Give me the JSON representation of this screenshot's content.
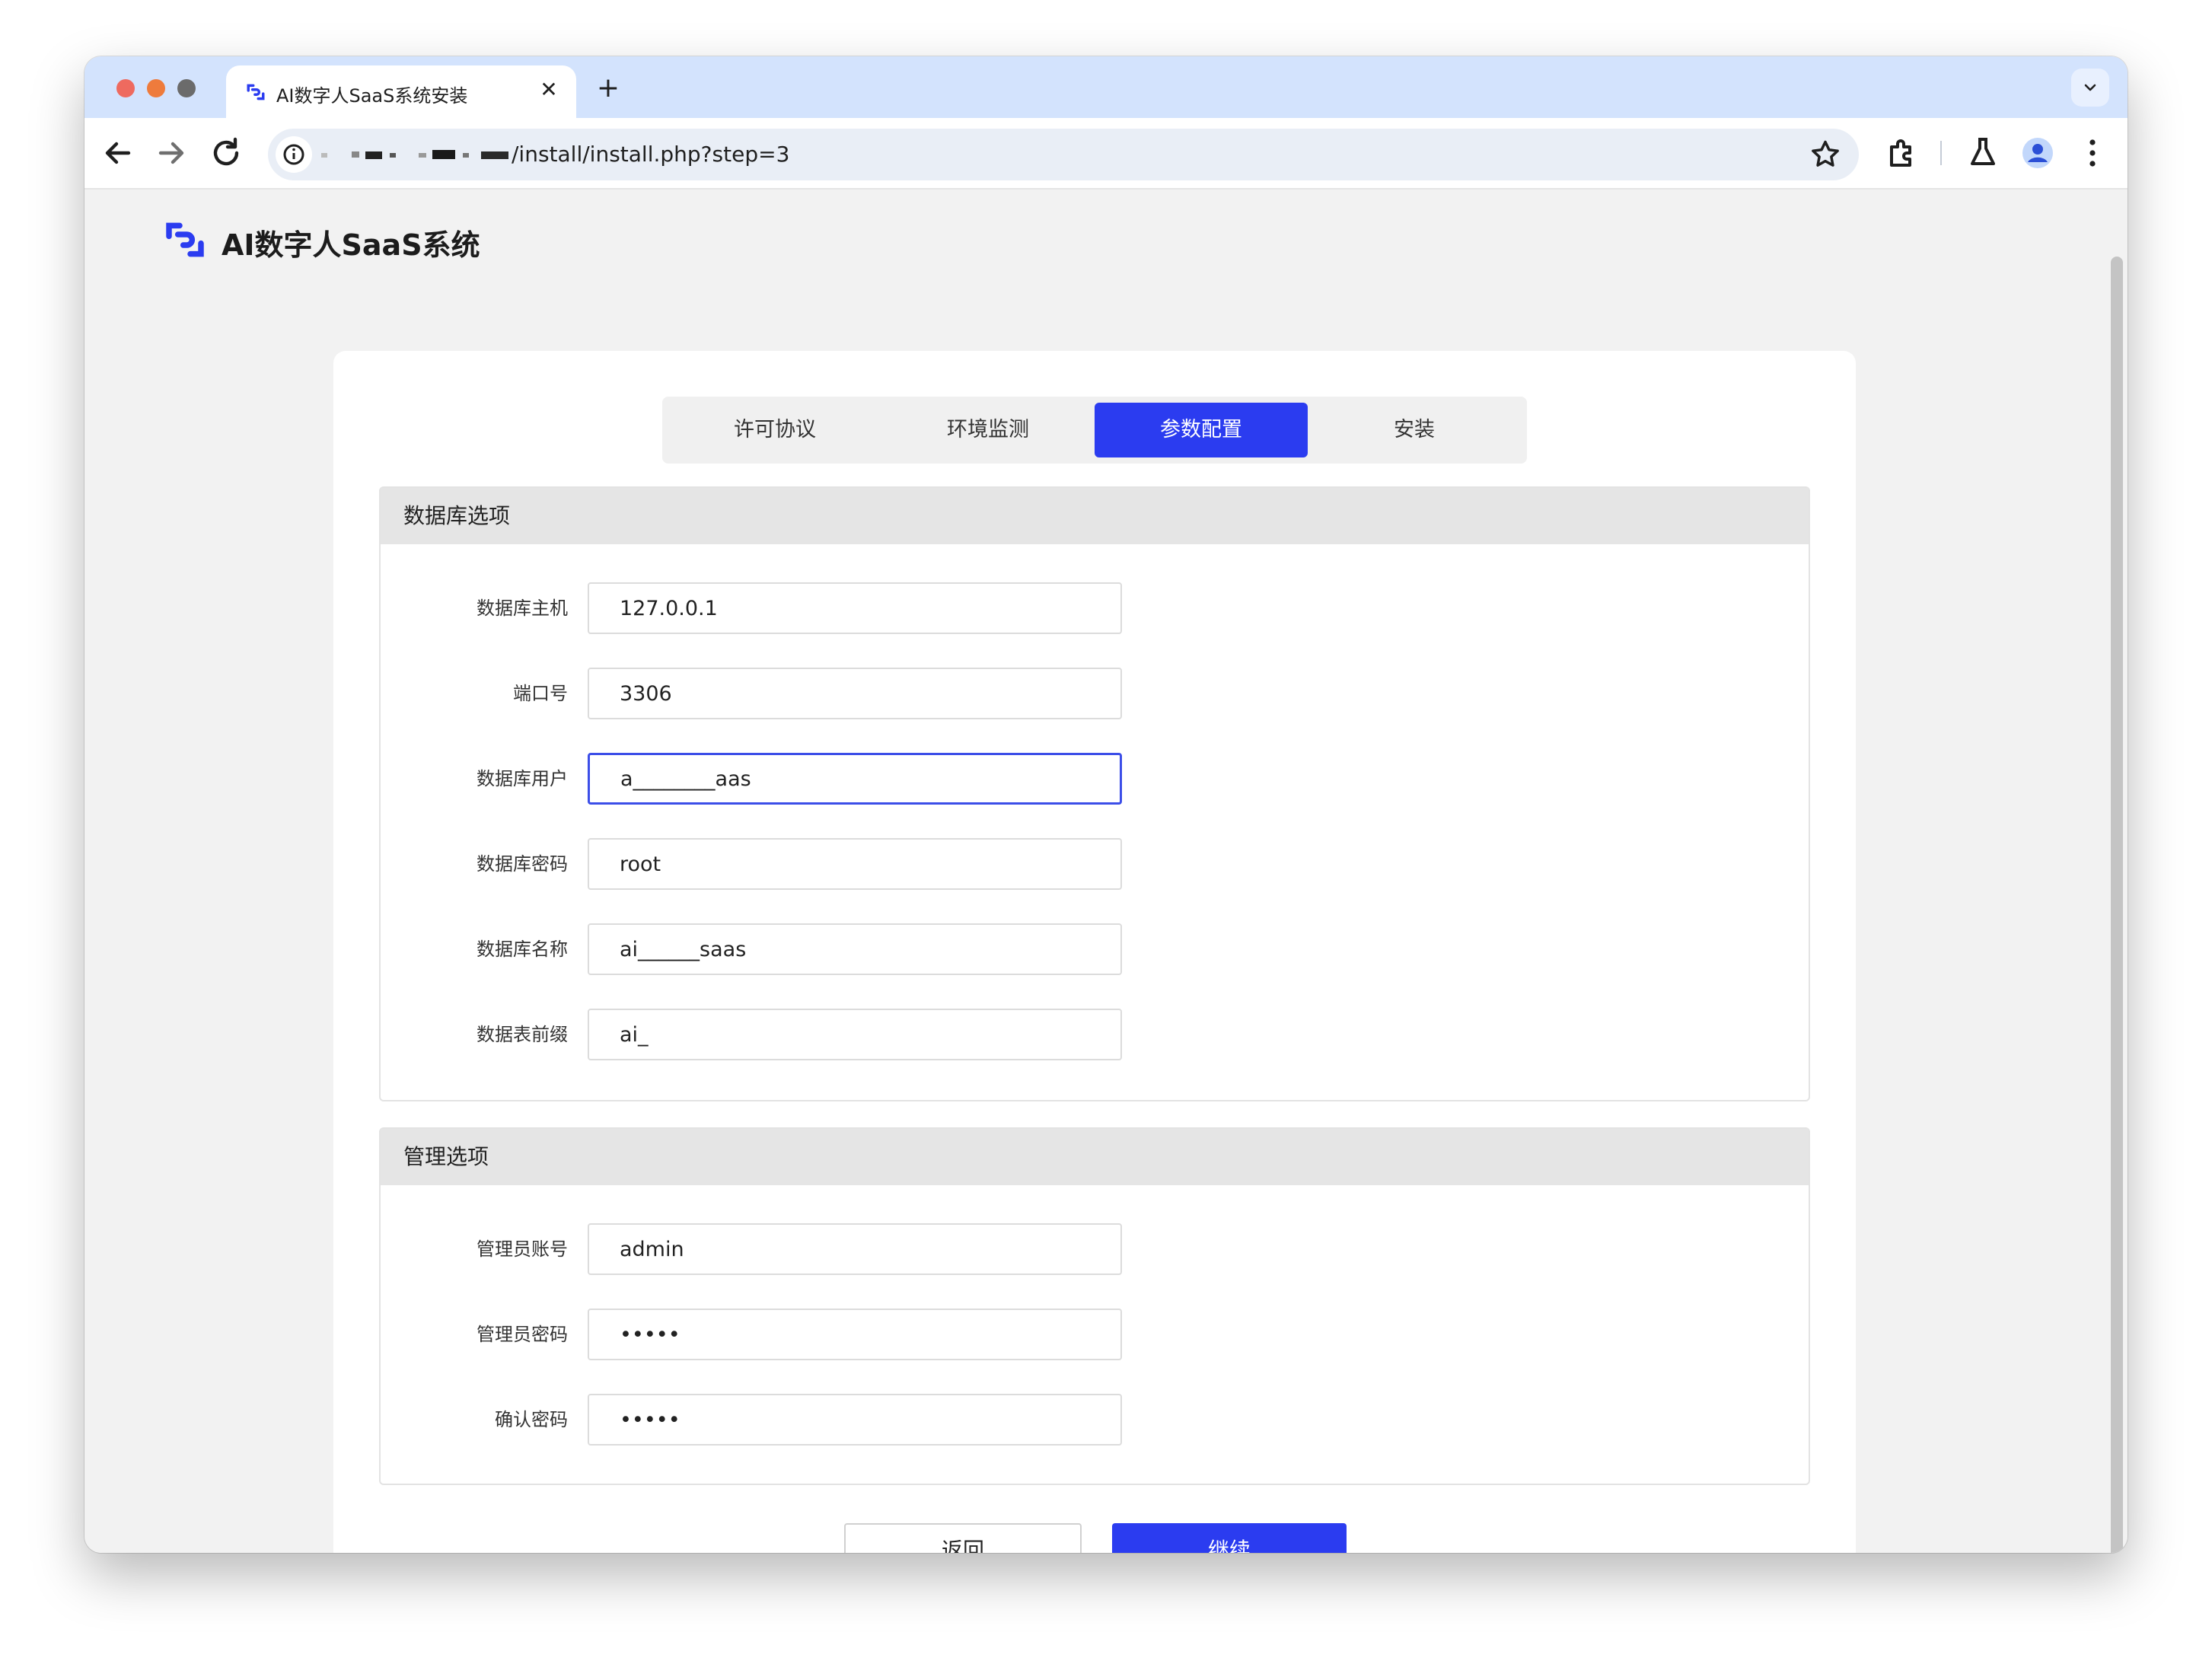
{
  "browser": {
    "tab_title": "AI数字人SaaS系统安装",
    "url_path": "/install/install.php?step=3",
    "new_tab_label": "+",
    "close_tab_label": "✕"
  },
  "page": {
    "logo_text": "AI数字人SaaS系统",
    "brand_color": "#2b3cf0",
    "steps": [
      {
        "label": "许可协议",
        "active": false
      },
      {
        "label": "环境监测",
        "active": false
      },
      {
        "label": "参数配置",
        "active": true
      },
      {
        "label": "安装",
        "active": false
      }
    ],
    "db_section": {
      "title": "数据库选项",
      "fields": [
        {
          "label": "数据库主机",
          "value": "127.0.0.1"
        },
        {
          "label": "端口号",
          "value": "3306"
        },
        {
          "label": "数据库用户",
          "value": "a________aas"
        },
        {
          "label": "数据库密码",
          "value": "root"
        },
        {
          "label": "数据库名称",
          "value": "ai______saas"
        },
        {
          "label": "数据表前缀",
          "value": "ai_"
        }
      ]
    },
    "admin_section": {
      "title": "管理选项",
      "fields": [
        {
          "label": "管理员账号",
          "value": "admin"
        },
        {
          "label": "管理员密码",
          "value": "•••••"
        },
        {
          "label": "确认密码",
          "value": "•••••"
        }
      ]
    },
    "back_button": "返回",
    "continue_button": "继续"
  }
}
